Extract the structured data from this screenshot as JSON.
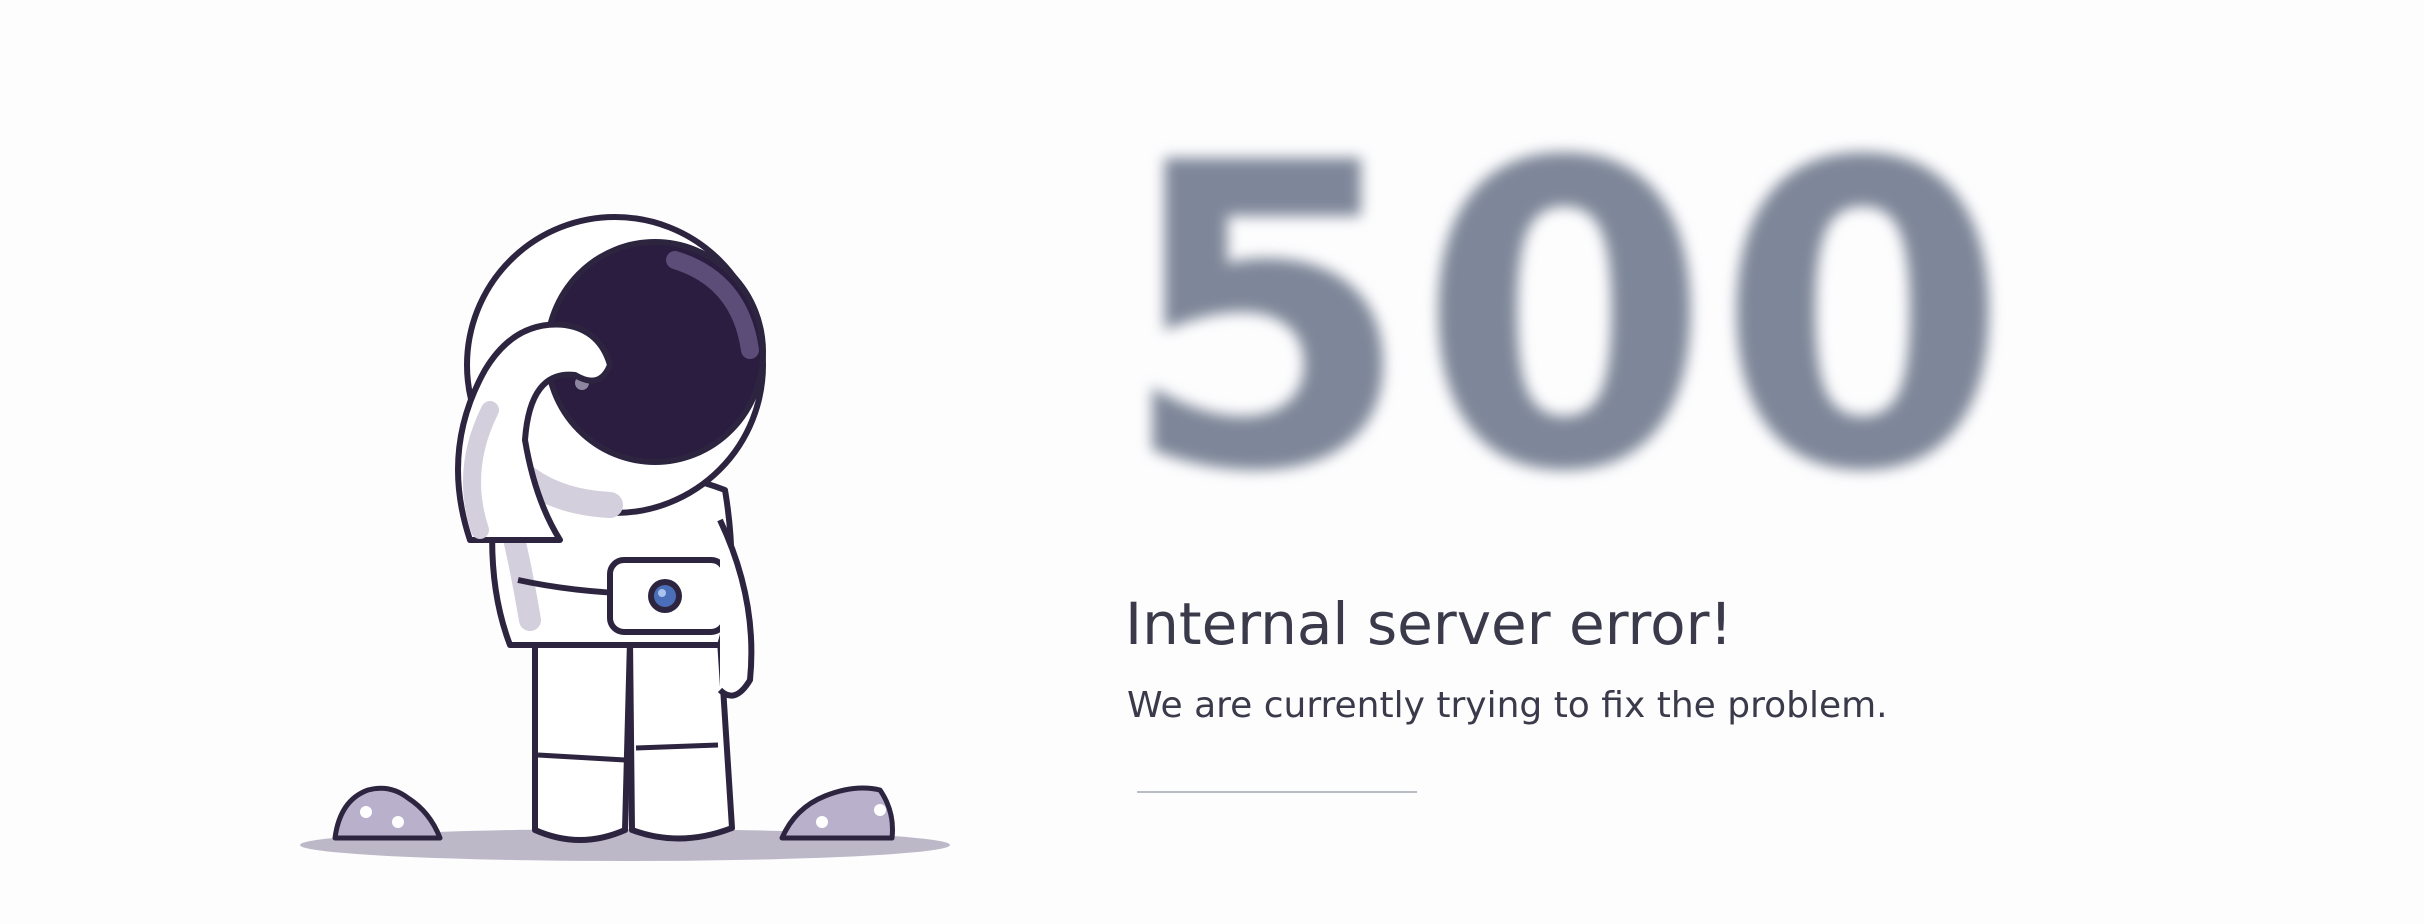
{
  "error": {
    "code": "500",
    "title": "Internal server error!",
    "message": "We are currently trying to fix the problem."
  },
  "illustration": {
    "icon": "astronaut-icon",
    "colors": {
      "outline": "#2d2440",
      "visor": "#2a1d40",
      "shadow": "#bdb8c8",
      "rock": "#b9b0cc"
    }
  }
}
